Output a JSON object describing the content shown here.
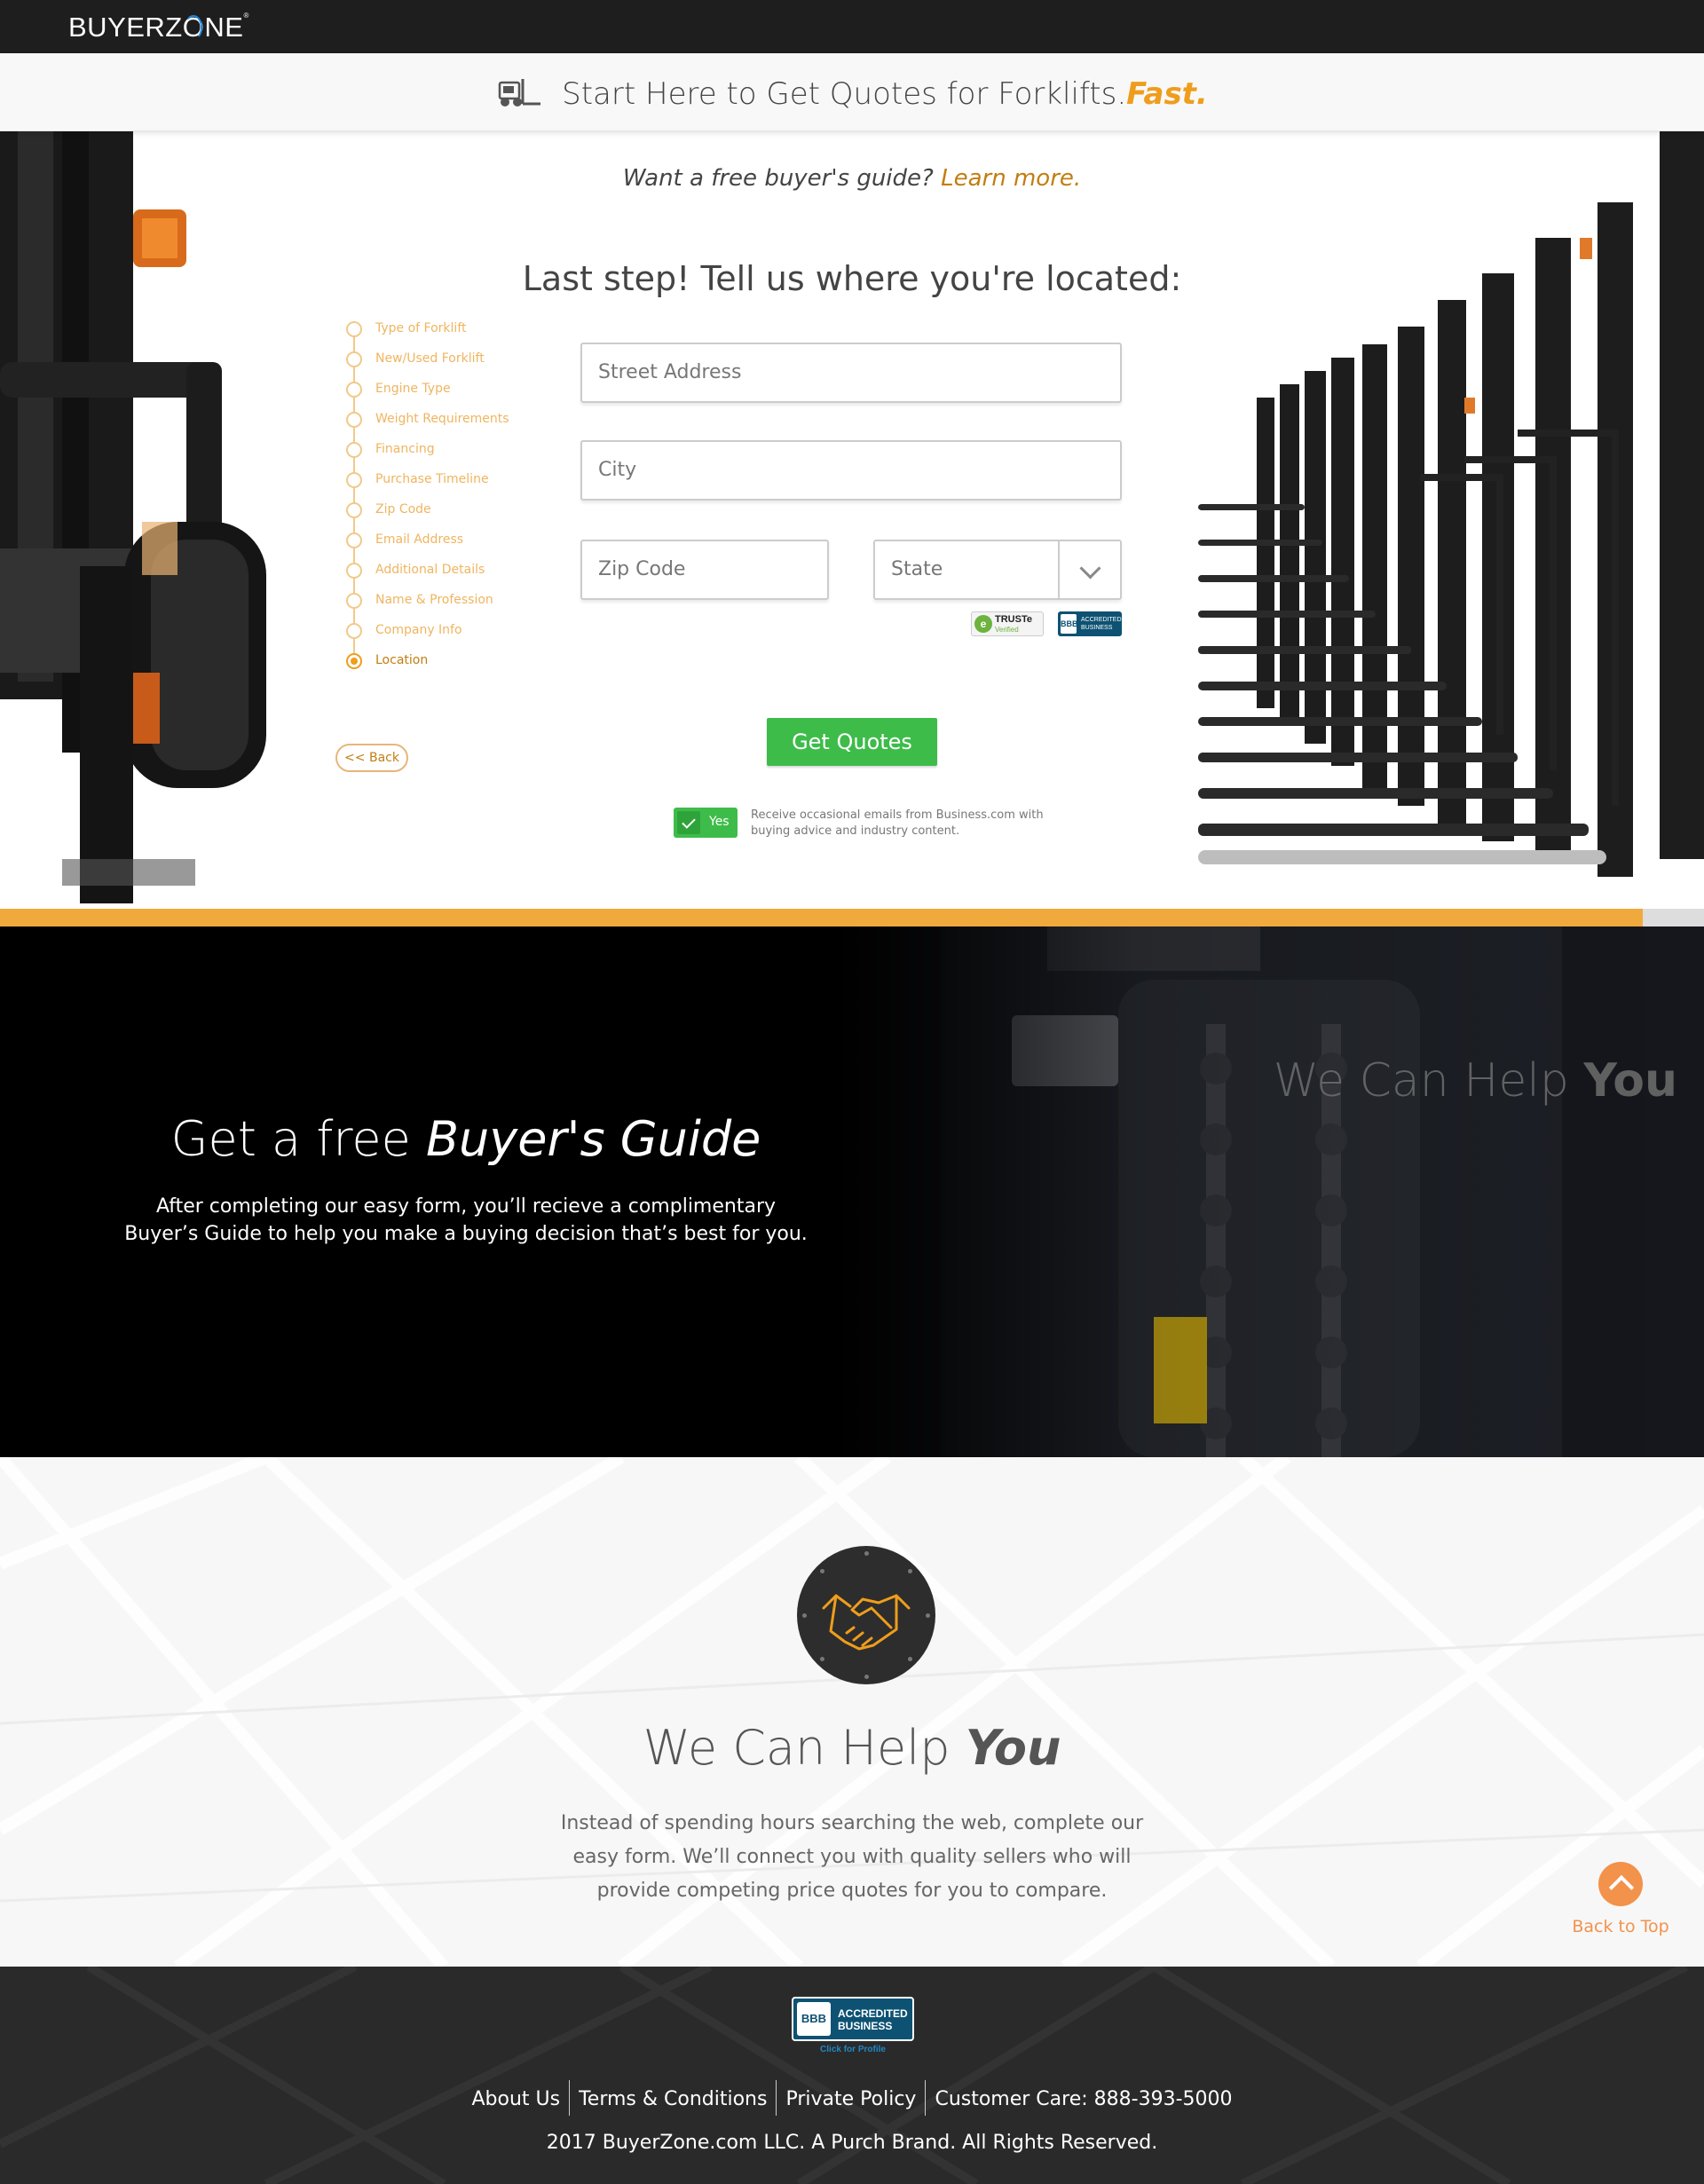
{
  "brand": {
    "logo_text_a": "BUYERZ",
    "logo_text_o": "O",
    "logo_text_b": "NE",
    "logo_mark": "®"
  },
  "banner": {
    "title": "Start Here to Get Quotes for Forklifts.",
    "accent": "Fast.",
    "icon": "forklift-icon"
  },
  "guide": {
    "prompt": "Want a free buyer's guide?",
    "link": "Learn more."
  },
  "form": {
    "title": "Last step! Tell us where you're located:",
    "street_placeholder": "Street Address",
    "city_placeholder": "City",
    "zip_placeholder": "Zip Code",
    "state_placeholder": "State",
    "submit": "Get Quotes",
    "consent_toggle": "Yes",
    "consent_text": "Receive occasional emails from Business.com with buying advice and industry content."
  },
  "seals": {
    "truste_label": "TRUSTe",
    "truste_sub": "Verified",
    "bbb_label": "ACCREDITED BUSINESS"
  },
  "progress_steps": [
    "Type of Forklift",
    "New/Used Forklift",
    "Engine Type",
    "Weight Requirements",
    "Financing",
    "Purchase Timeline",
    "Zip Code",
    "Email Address",
    "Additional Details",
    "Name & Profession",
    "Company Info",
    "Location"
  ],
  "active_step": "Location",
  "back_label": "<< Back",
  "form_progress": 0.964,
  "colors": {
    "accent": "#ef9d1c",
    "submit_green": "#3ebc4a",
    "dark": "#1e1e1e"
  },
  "dark_section": {
    "title_light": "Get a free",
    "title_bold": "Buyer's Guide",
    "text_line1": "After completing our easy form, you’ll recieve a complimentary",
    "text_line2": "Buyer’s Guide to help you make a buying decision that’s best for you.",
    "overlay_light": "We Can Help",
    "overlay_bold": "You"
  },
  "help_section": {
    "icon": "handshake-icon",
    "title_light": "We Can Help",
    "title_bold": "You",
    "text": "Instead of spending hours searching the web, complete our easy form. We’ll connect you with quality sellers who will provide competing price quotes for you to compare."
  },
  "back_to_top": "Back to Top",
  "footer": {
    "bbb_mark": "BBB",
    "bbb_line1": "ACCREDITED",
    "bbb_line2": "BUSINESS",
    "bbb_sub": "Click for Profile",
    "links": [
      "About Us",
      "Terms & Conditions",
      "Private Policy",
      "Customer Care: 888-393-5000"
    ],
    "copyright": "2017 BuyerZone.com LLC. A Purch Brand. All Rights Reserved."
  }
}
